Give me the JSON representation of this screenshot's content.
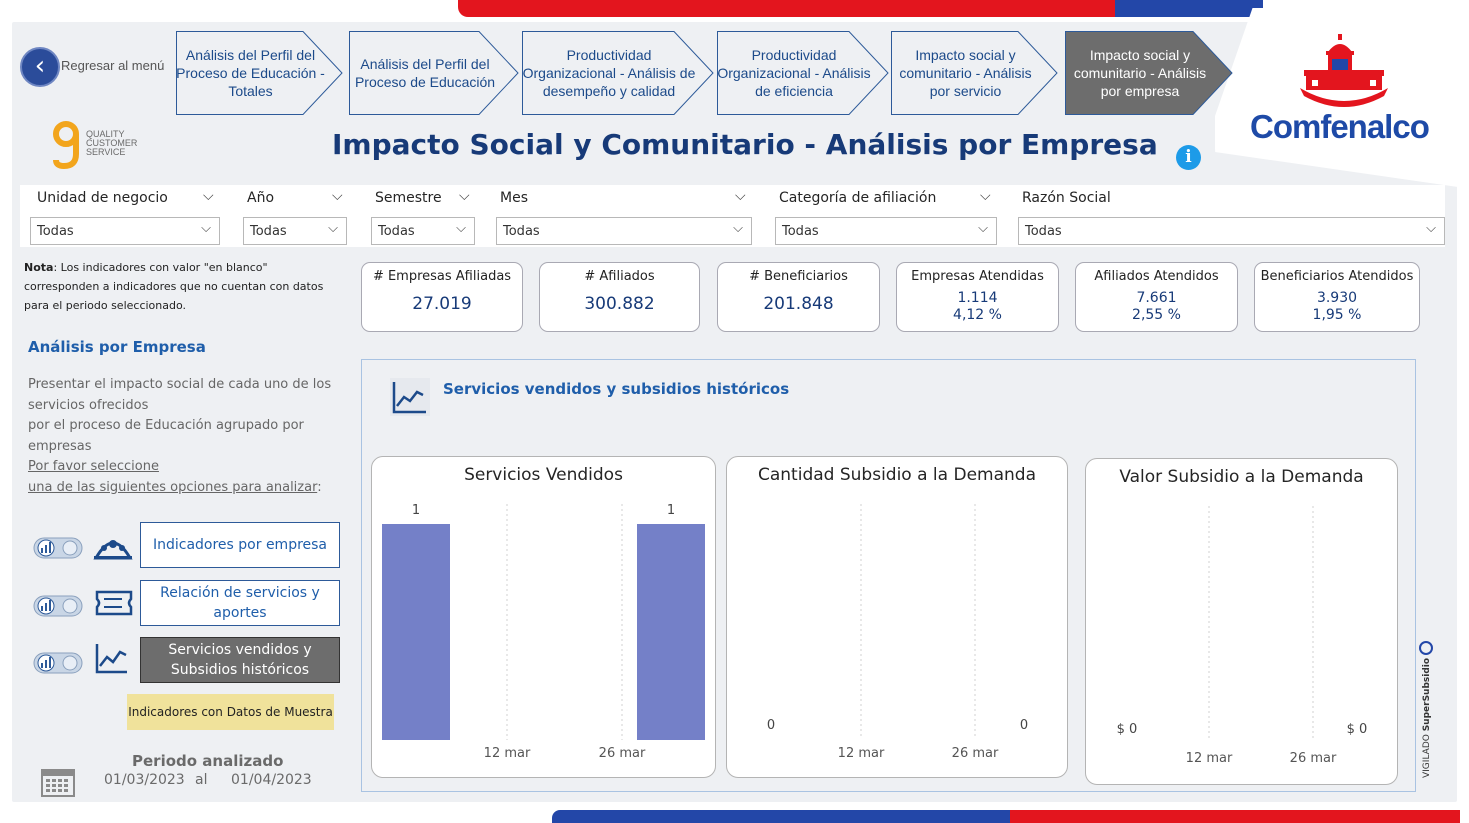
{
  "brand": {
    "logo_text": "Comfenalco",
    "qcs_lines": [
      "QUALITY",
      "CUSTOMER",
      "SERVICE"
    ],
    "red": "#e3151e",
    "blue": "#2347a8"
  },
  "nav": {
    "back_label": "Regresar al menú",
    "steps": [
      {
        "label": "Análisis del Perfil del Proceso de Educación - Totales",
        "active": false
      },
      {
        "label": "Análisis del Perfil del Proceso de Educación",
        "active": false
      },
      {
        "label": "Productividad Organizacional - Análisis de desempeño y calidad",
        "active": false
      },
      {
        "label": "Productividad Organizacional - Análisis de eficiencia",
        "active": false
      },
      {
        "label": "Impacto social y comunitario - Análisis por servicio",
        "active": false
      },
      {
        "label": "Impacto social y comunitario - Análisis por empresa",
        "active": true
      }
    ]
  },
  "page_title": "Impacto Social y Comunitario - Análisis por Empresa",
  "info_icon": "info-icon",
  "filters": [
    {
      "label": "Unidad de negocio",
      "value": "Todas"
    },
    {
      "label": "Año",
      "value": "Todas"
    },
    {
      "label": "Semestre",
      "value": "Todas"
    },
    {
      "label": "Mes",
      "value": "Todas"
    },
    {
      "label": "Categoría de afiliación",
      "value": "Todas"
    },
    {
      "label": "Razón Social",
      "value": "Todas"
    }
  ],
  "note": {
    "bold": "Nota",
    "text": ": Los indicadores con valor \"en blanco\" corresponden a indicadores que no cuentan con datos para el periodo seleccionado."
  },
  "kpis": [
    {
      "label": "# Empresas Afiliadas",
      "value": "27.019"
    },
    {
      "label": "# Afiliados",
      "value": "300.882"
    },
    {
      "label": "# Beneficiarios",
      "value": "201.848"
    },
    {
      "label": "Empresas Atendidas",
      "value": "1.114",
      "pct": "4,12 %"
    },
    {
      "label": "Afiliados Atendidos",
      "value": "7.661",
      "pct": "2,55 %"
    },
    {
      "label": "Beneficiarios Atendidos",
      "value": "3.930",
      "pct": "1,95 %"
    }
  ],
  "left": {
    "title": "Análisis por Empresa",
    "desc1": "Presentar el impacto social de cada uno de los servicios ofrecidos",
    "desc2": "por el proceso de Educación agrupado por empresas",
    "desc3": "Por favor seleccione",
    "desc4": "una de las siguientes opciones para analizar",
    "desc4_suffix": ":",
    "options": [
      {
        "label": "Indicadores por empresa",
        "icon": "users-group-icon",
        "active": false
      },
      {
        "label": "Relación de servicios y aportes",
        "icon": "ticket-icon",
        "active": false
      },
      {
        "label": "Servicios vendidos y Subsidios históricos",
        "icon": "line-chart-icon",
        "active": true
      }
    ],
    "demo_note": "Indicadores con Datos de Muestra",
    "period_title": "Periodo analizado",
    "period_from": "01/03/2023",
    "period_sep": "al",
    "period_to": "01/04/2023"
  },
  "panel": {
    "title": "Servicios vendidos y subsidios históricos",
    "icon": "trend-chart-icon"
  },
  "chart_data": [
    {
      "type": "bar",
      "title": "Servicios Vendidos",
      "x_ticks": [
        "12 mar",
        "26 mar"
      ],
      "categories": [
        "01/03/2023",
        "01/04/2023"
      ],
      "values": [
        1,
        1
      ],
      "data_labels": [
        "1",
        "1"
      ],
      "ylim": [
        0,
        1
      ],
      "bar_color": "#7480c8",
      "grid": false
    },
    {
      "type": "bar",
      "title": "Cantidad Subsidio a la Demanda",
      "x_ticks": [
        "12 mar",
        "26 mar"
      ],
      "categories": [
        "01/03/2023",
        "01/04/2023"
      ],
      "values": [
        0,
        0
      ],
      "data_labels": [
        "0",
        "0"
      ],
      "grid": false
    },
    {
      "type": "bar",
      "title": "Valor Subsidio a la Demanda",
      "x_ticks": [
        "12 mar",
        "26 mar"
      ],
      "categories": [
        "01/03/2023",
        "01/04/2023"
      ],
      "values": [
        0,
        0
      ],
      "data_labels": [
        "$ 0",
        "$ 0"
      ],
      "grid": false
    }
  ],
  "vigilado": {
    "pre": "VIGILADO ",
    "bold": "SuperSubsidio"
  }
}
